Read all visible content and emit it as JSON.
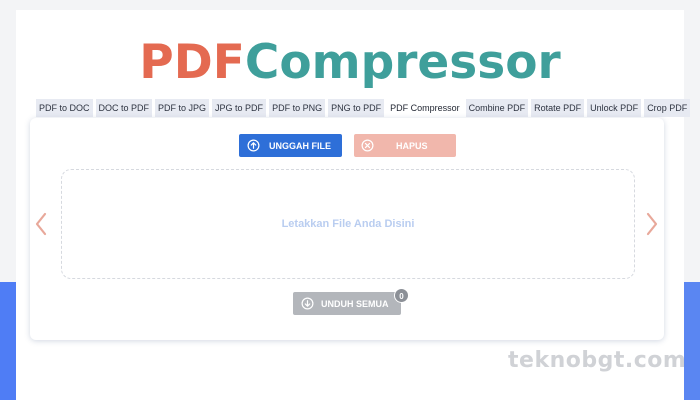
{
  "logo": {
    "part1": "PDF",
    "part2": "Compressor"
  },
  "tabs": [
    {
      "label": "PDF to DOC"
    },
    {
      "label": "DOC to PDF"
    },
    {
      "label": "PDF to JPG"
    },
    {
      "label": "JPG to PDF"
    },
    {
      "label": "PDF to PNG"
    },
    {
      "label": "PNG to PDF"
    },
    {
      "label": "PDF Compressor",
      "active": true
    },
    {
      "label": "Combine PDF"
    },
    {
      "label": "Rotate PDF"
    },
    {
      "label": "Unlock PDF"
    },
    {
      "label": "Crop PDF"
    }
  ],
  "toolbar": {
    "upload_label": "UNGGAH FILE",
    "delete_label": "HAPUS"
  },
  "dropzone": {
    "text": "Letakkan File Anda Disini"
  },
  "footer": {
    "download_label": "UNDUH SEMUA",
    "file_count": "0"
  },
  "watermark": "teknobgt.com",
  "colors": {
    "logo_pdf": "#e46a51",
    "logo_compressor": "#3f9f9b",
    "upload_button": "#2e6fd8",
    "delete_button": "#f1b7ac",
    "download_button": "#b3b6bb",
    "arrows": "#e8a89a",
    "background_band": "#4f7df5"
  },
  "icons": {
    "upload": "arrow-up-circle-icon",
    "delete": "x-circle-icon",
    "download": "arrow-down-circle-icon",
    "prev": "chevron-left-icon",
    "next": "chevron-right-icon"
  }
}
